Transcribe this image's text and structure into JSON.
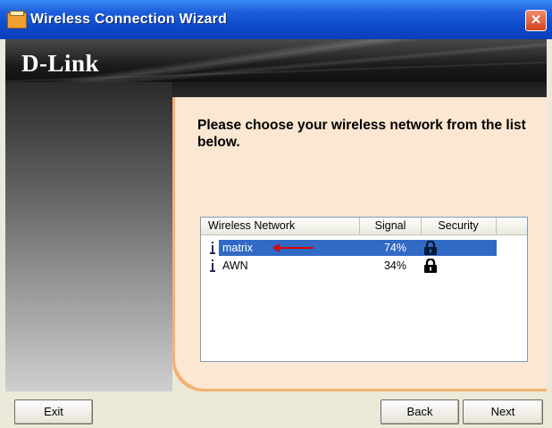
{
  "window": {
    "title": "Wireless Connection Wizard",
    "close_glyph": "✕",
    "app_icon": "wizard-app-icon"
  },
  "banner": {
    "brand": "D-Link"
  },
  "content": {
    "instruction": "Please choose your wireless network from the list below."
  },
  "network_list": {
    "columns": [
      "Wireless Network",
      "Signal",
      "Security",
      ""
    ],
    "rows": [
      {
        "name": "matrix",
        "signal": "74%",
        "secured": true,
        "selected": true
      },
      {
        "name": "AWN",
        "signal": "34%",
        "secured": true,
        "selected": false
      }
    ]
  },
  "annotation": {
    "arrow_color": "#e00000",
    "arrow_points_to": "matrix"
  },
  "buttons": {
    "exit": "Exit",
    "back": "Back",
    "next": "Next"
  },
  "colors": {
    "selection": "#316ac5",
    "panel": "#fbe7d2",
    "accent_orange": "#f3b274"
  }
}
